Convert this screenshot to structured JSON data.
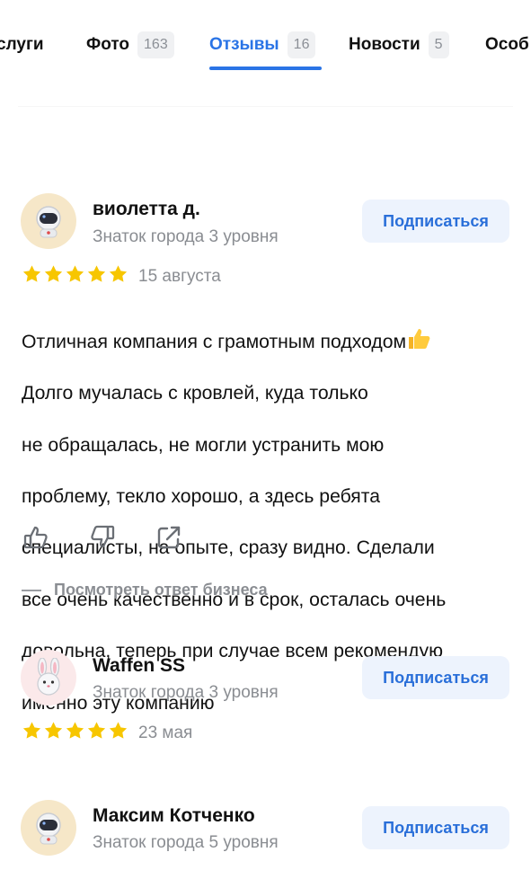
{
  "tabs": [
    {
      "label": "Услуги",
      "count": "",
      "active": false
    },
    {
      "label": "Фото",
      "count": "163",
      "active": false
    },
    {
      "label": "Отзывы",
      "count": "16",
      "active": true
    },
    {
      "label": "Новости",
      "count": "5",
      "active": false
    },
    {
      "label": "Особ",
      "count": "",
      "active": false
    }
  ],
  "tab_partial_first": "слуги",
  "accent_color": "#2a74e6",
  "star_color": "#f7c600",
  "reviews": [
    {
      "author": "виолетта д.",
      "rank": "Знаток города 3 уровня",
      "subscribe_label": "Подписаться",
      "rating": 5,
      "date": "15 августа",
      "text_lines": [
        "Отличная компания с грамотным подходом",
        "Долго мучалась с кровлей, куда только",
        "не обращалась, не могли устранить мою",
        "проблему, текло хорошо, а здесь ребята",
        "специалисты, на опыте, сразу видно. Сделали",
        "все очень качественно и в срок, осталась очень",
        "довольна, теперь при случае всем рекомендую",
        "именно эту компанию"
      ],
      "text_emoji": "thumbs-up-emoji",
      "avatar_icon": "astronaut-icon",
      "business_reply_label": "Посмотреть ответ бизнеса"
    },
    {
      "author": "Waffen SS",
      "rank": "Знаток города 3 уровня",
      "subscribe_label": "Подписаться",
      "rating": 5,
      "date": "23 мая",
      "avatar_icon": "rabbit-icon"
    },
    {
      "author": "Максим Котченко",
      "rank": "Знаток города 5 уровня",
      "subscribe_label": "Подписаться",
      "avatar_icon": "astronaut-icon"
    }
  ]
}
